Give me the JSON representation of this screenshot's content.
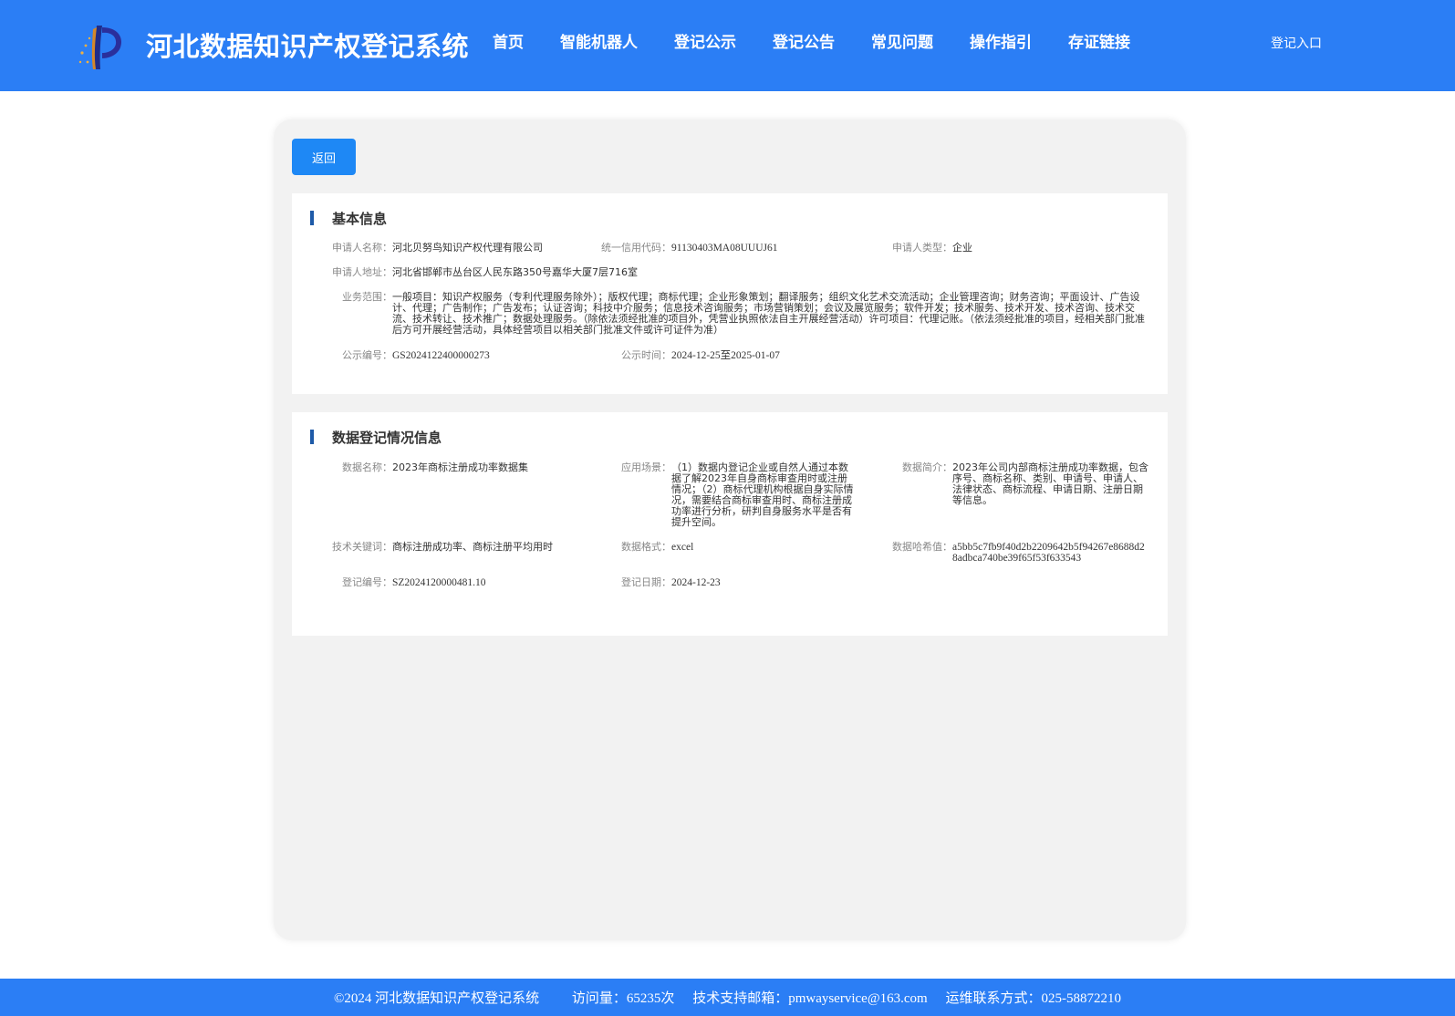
{
  "header": {
    "title": "河北数据知识产权登记系统",
    "nav": [
      "首页",
      "智能机器人",
      "登记公示",
      "登记公告",
      "常见问题",
      "操作指引",
      "存证链接"
    ],
    "login": "登记入口",
    "colors": {
      "brand": "#2b7ef5"
    }
  },
  "back_label": "返回",
  "basic": {
    "title": "基本信息",
    "applicant_name_label": "申请人名称：",
    "applicant_name": "河北贝努鸟知识产权代理有限公司",
    "credit_code_label": "统一信用代码：",
    "credit_code": "91130403MA08UUUJ61",
    "applicant_type_label": "申请人类型：",
    "applicant_type": "企业",
    "address_label": "申请人地址：",
    "address": "河北省邯郸市丛台区人民东路350号嘉华大厦7层716室",
    "scope_label": "业务范围：",
    "scope": "一般项目：知识产权服务（专利代理服务除外）；版权代理；商标代理；企业形象策划；翻译服务；组织文化艺术交流活动；企业管理咨询；财务咨询；平面设计、广告设计、代理；广告制作；广告发布；认证咨询；科技中介服务；信息技术咨询服务；市场营销策划；会议及展览服务；软件开发；技术服务、技术开发、技术咨询、技术交流、技术转让、技术推广；数据处理服务。（除依法须经批准的项目外，凭营业执照依法自主开展经营活动）许可项目：代理记账。（依法须经批准的项目，经相关部门批准后方可开展经营活动，具体经营项目以相关部门批准文件或许可证件为准）",
    "notice_no_label": "公示编号：",
    "notice_no": "GS2024122400000273",
    "notice_time_label": "公示时间：",
    "notice_time": "2024-12-25至2025-01-07"
  },
  "data": {
    "title": "数据登记情况信息",
    "name_label": "数据名称：",
    "name": "2023年商标注册成功率数据集",
    "scenario_label": "应用场景：",
    "scenario": "（1）数据内登记企业或自然人通过本数据了解2023年自身商标审查用时或注册情况；（2）商标代理机构根据自身实际情况，需要结合商标审查用时、商标注册成功率进行分析，研判自身服务水平是否有提升空间。",
    "intro_label": "数据简介：",
    "intro": "2023年公司内部商标注册成功率数据，包含序号、商标名称、类别、申请号、申请人、法律状态、商标流程、申请日期、注册日期等信息。",
    "keywords_label": "技术关键词：",
    "keywords": "商标注册成功率、商标注册平均用时",
    "format_label": "数据格式：",
    "format": "excel",
    "hash_label": "数据哈希值：",
    "hash": "a5bb5c7fb9f40d2b2209642b5f94267e8688d28adbca740be39f65f53f633543",
    "reg_no_label": "登记编号：",
    "reg_no": "SZ2024120000481.10",
    "reg_date_label": "登记日期：",
    "reg_date": "2024-12-23"
  },
  "footer": {
    "copyright": "©2024 河北数据知识产权登记系统",
    "visits": "访问量：65235次",
    "email": "技术支持邮箱：pmwayservice@163.com",
    "contact": "运维联系方式：025-58872210"
  }
}
